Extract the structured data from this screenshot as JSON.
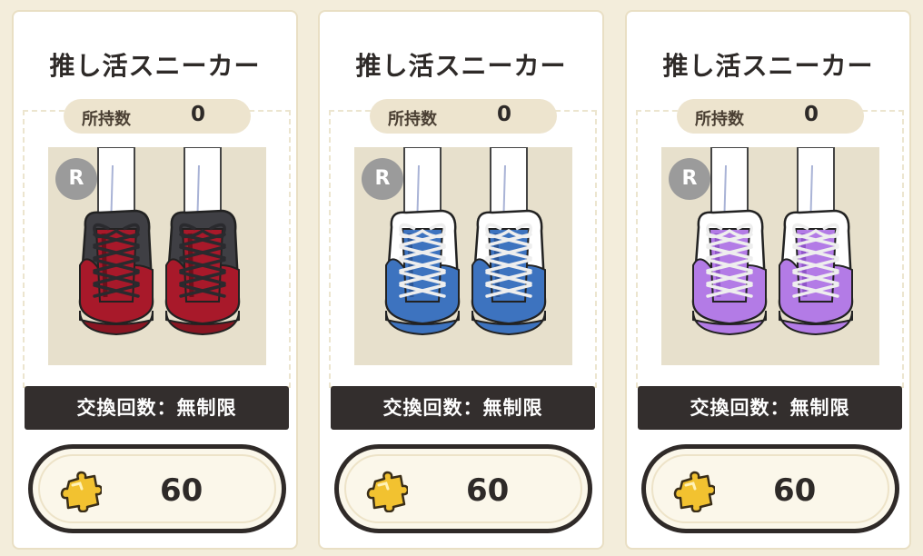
{
  "items": [
    {
      "title": "推し活スニーカー",
      "owned_label": "所持数",
      "owned_count": "0",
      "rarity": "R",
      "exchange_limit": "交換回数：無制限",
      "cost": "60",
      "shoe_color": "red",
      "colors": {
        "main": "#a8192a",
        "shade": "#6e0f1a",
        "upper": "#3f3f44",
        "lace": "#2a2a2e",
        "sole": "#8a1522"
      }
    },
    {
      "title": "推し活スニーカー",
      "owned_label": "所持数",
      "owned_count": "0",
      "rarity": "R",
      "exchange_limit": "交換回数：無制限",
      "cost": "60",
      "shoe_color": "blue",
      "colors": {
        "main": "#3d73bf",
        "shade": "#2a5596",
        "upper": "#ffffff",
        "lace": "#eeeeee",
        "sole": "#3d73bf"
      }
    },
    {
      "title": "推し活スニーカー",
      "owned_label": "所持数",
      "owned_count": "0",
      "rarity": "R",
      "exchange_limit": "交換回数：無制限",
      "cost": "60",
      "shoe_color": "purple",
      "colors": {
        "main": "#b37be6",
        "shade": "#8f55c8",
        "upper": "#ffffff",
        "lace": "#eeeeee",
        "sole": "#b37be6"
      }
    }
  ],
  "icons": {
    "cost_icon": "puzzle-piece-icon",
    "rarity_badge": "rarity-badge"
  },
  "theme": {
    "background": "#f3eddb",
    "card_border": "#e9dfc4",
    "dark_bar": "#332e2d",
    "pill": "#ede4ce",
    "puzzle_gold": "#f2c230"
  }
}
